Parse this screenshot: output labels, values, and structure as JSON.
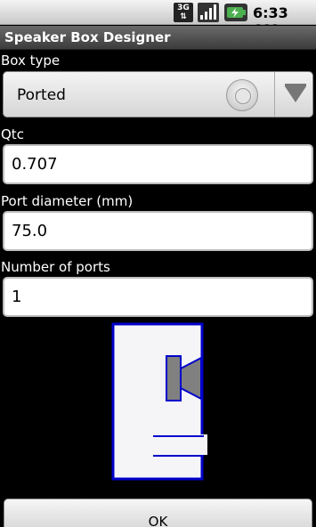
{
  "status_bar": {
    "network": "3G",
    "time": "6:33 AM",
    "icons": [
      "3g-icon",
      "signal-icon",
      "battery-icon"
    ]
  },
  "app": {
    "title": "Speaker Box Designer"
  },
  "form": {
    "box_type_label": "Box type",
    "box_type_value": "Ported",
    "qtc_label": "Qtc",
    "qtc_value": "0.707",
    "port_diameter_label": "Port diameter (mm)",
    "port_diameter_value": "75.0",
    "ports_label": "Number of ports",
    "ports_value": "1"
  },
  "diagram": {
    "type": "ported-box",
    "outline_color": "#0000cc",
    "driver_color": "#808080"
  },
  "actions": {
    "ok_label": "OK"
  }
}
